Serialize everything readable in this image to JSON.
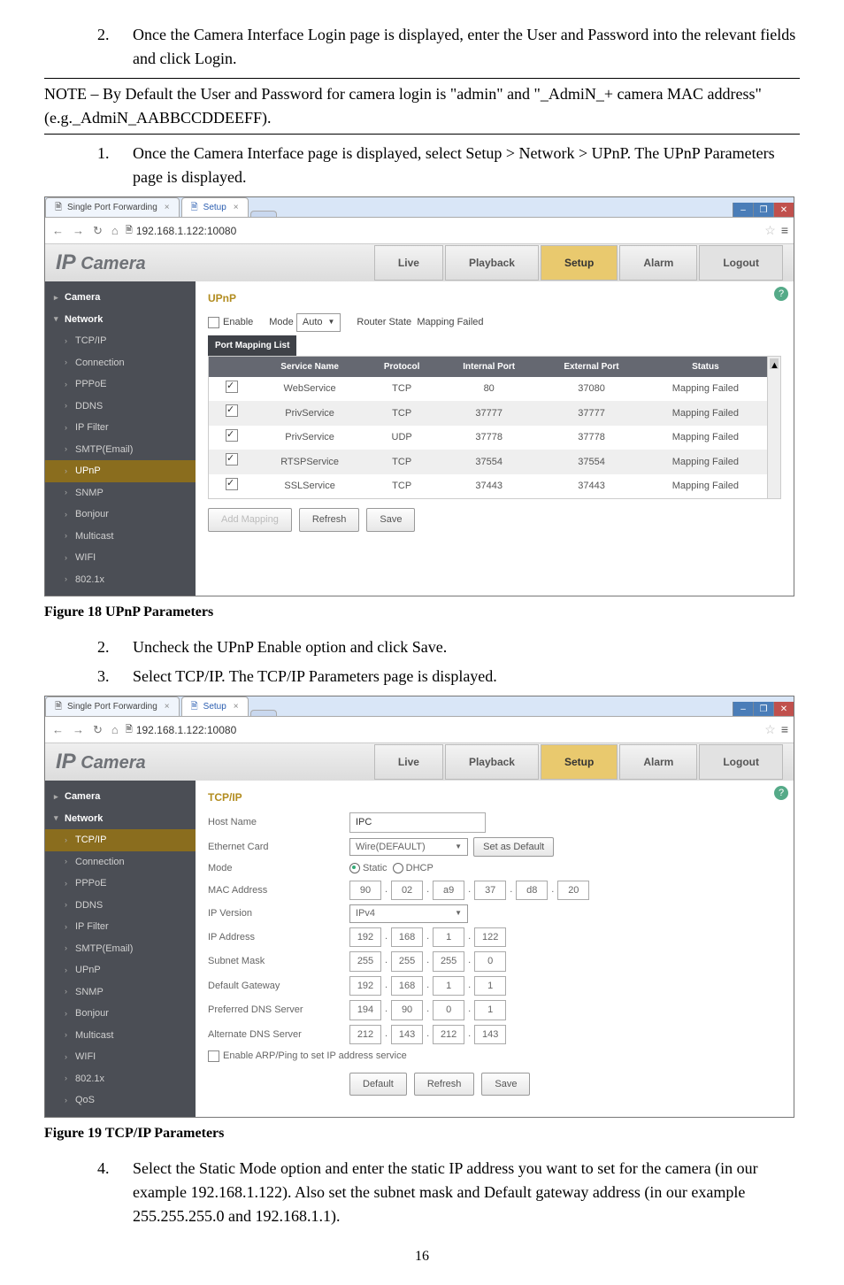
{
  "step2_intro": "Once the Camera Interface Login page is displayed, enter the User and Password into the relevant fields and click Login.",
  "note_text": "NOTE – By Default the User and Password for camera login is \"admin\" and \"_AdmiN_+ camera MAC address\" (e.g._AdmiN_AABBCCDDEEFF).",
  "step1_upnp": "Once the Camera Interface page is displayed, select Setup > Network > UPnP. The UPnP Parameters page is displayed.",
  "browser1": {
    "tabs": {
      "t1": "Single Port Forwarding",
      "t2": "Setup"
    },
    "url": "192.168.1.122:10080",
    "logo": "IP Camera",
    "nav": {
      "live": "Live",
      "playback": "Playback",
      "setup": "Setup",
      "alarm": "Alarm",
      "logout": "Logout"
    },
    "sidebar": {
      "camera": "Camera",
      "network": "Network",
      "tcpip": "TCP/IP",
      "connection": "Connection",
      "pppoe": "PPPoE",
      "ddns": "DDNS",
      "ipfilter": "IP Filter",
      "smtp": "SMTP(Email)",
      "upnp": "UPnP",
      "snmp": "SNMP",
      "bonjour": "Bonjour",
      "multicast": "Multicast",
      "wifi": "WIFI",
      "x8021": "802.1x"
    },
    "content": {
      "title": "UPnP",
      "enable": "Enable",
      "mode": "Mode",
      "auto": "Auto",
      "router_state": "Router State",
      "mapping_failed": "Mapping Failed",
      "pml": "Port Mapping List",
      "headers": {
        "svc": "Service Name",
        "proto": "Protocol",
        "iport": "Internal Port",
        "eport": "External Port",
        "status": "Status"
      },
      "rows": [
        {
          "svc": "WebService",
          "proto": "TCP",
          "iport": "80",
          "eport": "37080",
          "status": "Mapping Failed"
        },
        {
          "svc": "PrivService",
          "proto": "TCP",
          "iport": "37777",
          "eport": "37777",
          "status": "Mapping Failed"
        },
        {
          "svc": "PrivService",
          "proto": "UDP",
          "iport": "37778",
          "eport": "37778",
          "status": "Mapping Failed"
        },
        {
          "svc": "RTSPService",
          "proto": "TCP",
          "iport": "37554",
          "eport": "37554",
          "status": "Mapping Failed"
        },
        {
          "svc": "SSLService",
          "proto": "TCP",
          "iport": "37443",
          "eport": "37443",
          "status": "Mapping Failed"
        }
      ],
      "buttons": {
        "add": "Add Mapping",
        "refresh": "Refresh",
        "save": "Save"
      }
    }
  },
  "fig18": "Figure 18 UPnP Parameters",
  "step2_uncheck": "Uncheck the UPnP Enable option and click Save.",
  "step3_tcpip": "Select TCP/IP. The TCP/IP Parameters page is displayed.",
  "browser2": {
    "content": {
      "title": "TCP/IP",
      "hostname": "Host Name",
      "hostname_val": "IPC",
      "ethernet": "Ethernet Card",
      "ethernet_val": "Wire(DEFAULT)",
      "setdefault": "Set as Default",
      "mode": "Mode",
      "static": "Static",
      "dhcp": "DHCP",
      "mac": "MAC Address",
      "mac_segs": [
        "90",
        "02",
        "a9",
        "37",
        "d8",
        "20"
      ],
      "ipver": "IP Version",
      "ipver_val": "IPv4",
      "ipaddr": "IP Address",
      "ipaddr_segs": [
        "192",
        "168",
        "1",
        "122"
      ],
      "subnet": "Subnet Mask",
      "subnet_segs": [
        "255",
        "255",
        "255",
        "0"
      ],
      "gateway": "Default Gateway",
      "gateway_segs": [
        "192",
        "168",
        "1",
        "1"
      ],
      "pdns": "Preferred DNS Server",
      "pdns_segs": [
        "194",
        "90",
        "0",
        "1"
      ],
      "adns": "Alternate DNS Server",
      "adns_segs": [
        "212",
        "143",
        "212",
        "143"
      ],
      "arp": "Enable ARP/Ping to set IP address service",
      "buttons": {
        "default": "Default",
        "refresh": "Refresh",
        "save": "Save"
      }
    },
    "sidebar_extra": {
      "qos": "QoS"
    }
  },
  "fig19": "Figure 19 TCP/IP Parameters",
  "step4": "Select the Static Mode option and enter the static IP address you want to set for the camera (in our example 192.168.1.122). Also set the subnet mask and Default gateway address (in our example 255.255.255.0 and 192.168.1.1).",
  "pagenum": "16"
}
